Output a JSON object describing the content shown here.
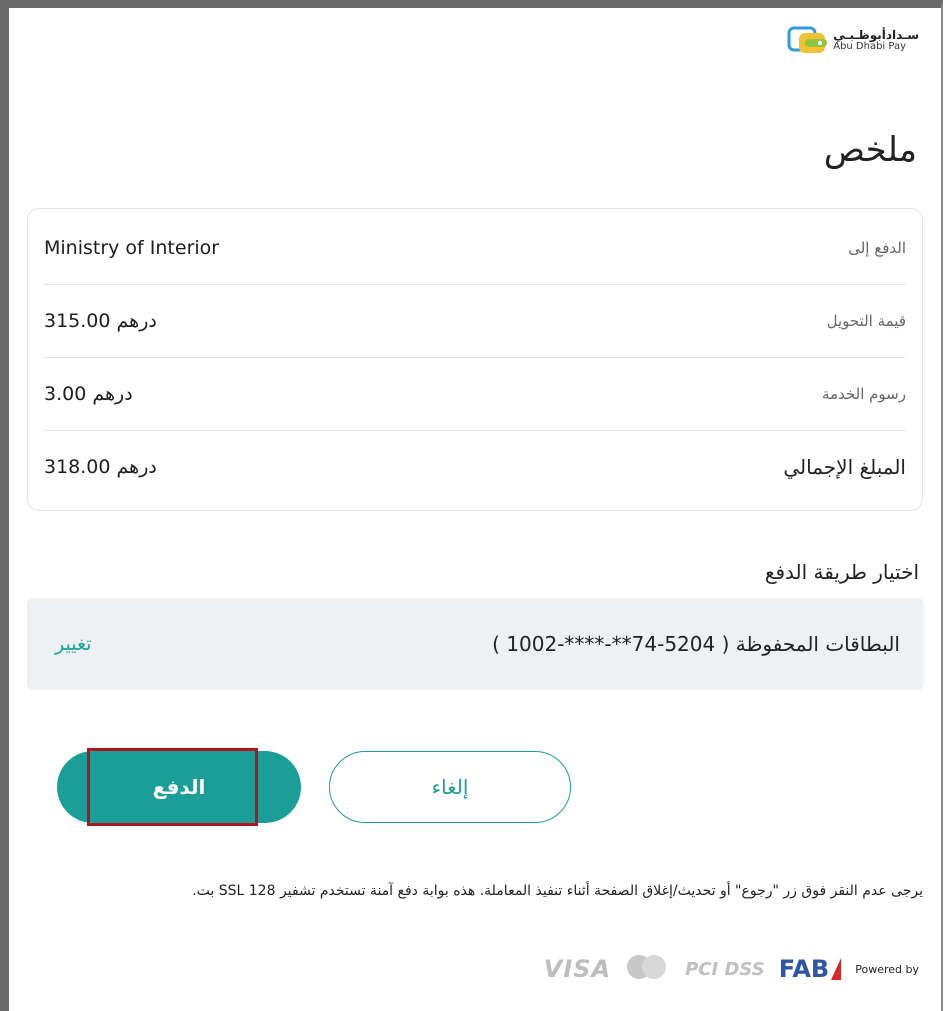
{
  "brand": {
    "arabic": "سـدادأبوظـبـي",
    "english": "Abu Dhabi Pay"
  },
  "title": "ملخص",
  "summary": {
    "rows": [
      {
        "label": "الدفع إلى",
        "value": "Ministry of Interior"
      },
      {
        "label": "قيمة التحويل",
        "value": "315.00 درهم"
      },
      {
        "label": "رسوم الخدمة",
        "value": "3.00 درهم"
      },
      {
        "label": "المبلغ الإجمالي",
        "value": "318.00 درهم"
      }
    ]
  },
  "payment_method": {
    "heading": "اختيار طريقة الدفع",
    "selected": "البطاقات المحفوظة ( 5204-74**-****-1002 )",
    "change_label": "تغيير"
  },
  "buttons": {
    "pay": "الدفع",
    "cancel": "إلغاء"
  },
  "note": "يرجى عدم النقر فوق زر \"رجوع\" أو تحديث/إغلاق الصفحة أثناء تنفيذ المعاملة. هذه بوابة دفع آمنة تستخدم تشفير SSL 128 بت.",
  "footer": {
    "visa": "VISA",
    "pci": "PCI DSS",
    "fab": "FAB",
    "powered_by": "Powered by"
  },
  "colors": {
    "accent": "#1b9e97",
    "highlight": "#b0151b",
    "method_bg": "#eef1f4"
  }
}
